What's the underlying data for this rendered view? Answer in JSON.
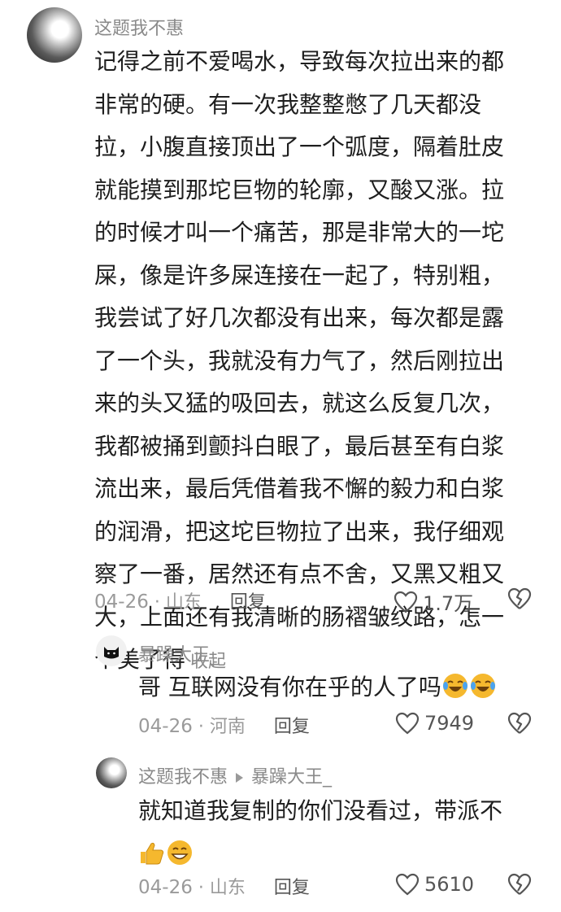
{
  "comments": [
    {
      "username": "这题我不惠",
      "lines": [
        "记得之前不爱喝水，导致每次拉出来的都",
        "非常的硬。有一次我整整憋了几天都没",
        "拉，小腹直接顶出了一个弧度，隔着肚皮",
        "就能摸到那坨巨物的轮廓，又酸又涨。拉",
        "的时候才叫一个痛苦，那是非常大的一坨",
        "屎，像是许多屎连接在一起了，特别粗，",
        "我尝试了好几次都没有出来，每次都是露",
        "了一个头，我就没有力气了，然后刚拉出",
        "来的头又猛的吸回去，就这么反复几次，",
        "我都被捅到颤抖白眼了，最后甚至有白浆",
        "流出来，最后凭借着我不懈的毅力和白浆",
        "的润滑，把这坨巨物拉了出来，我仔细观",
        "察了一番，居然还有点不舍，又黑又粗又",
        "大，上面还有我清晰的肠褶皱纹路，怎一",
        "个美了得"
      ],
      "collapse_label": "收起",
      "date": "04-26",
      "location": "山东",
      "reply_label": "回复",
      "likes": "1.7万"
    },
    {
      "username": "暴躁大王_",
      "text": "哥 互联网没有你在乎的人了吗",
      "emojis": [
        "laugh-cry-emoji",
        "laugh-cry-emoji"
      ],
      "date": "04-26",
      "location": "河南",
      "reply_label": "回复",
      "likes": "7949"
    },
    {
      "username": "这题我不惠",
      "reply_to": "暴躁大王_",
      "text": "就知道我复制的你们没看过，带派不",
      "emojis": [
        "thumbs-up-emoji",
        "grin-emoji"
      ],
      "date": "04-26",
      "location": "山东",
      "reply_label": "回复",
      "likes": "5610"
    }
  ],
  "colors": {
    "muted": "#9a9a9a",
    "text": "#1f1f1f",
    "emoji": "#f5b82e"
  }
}
